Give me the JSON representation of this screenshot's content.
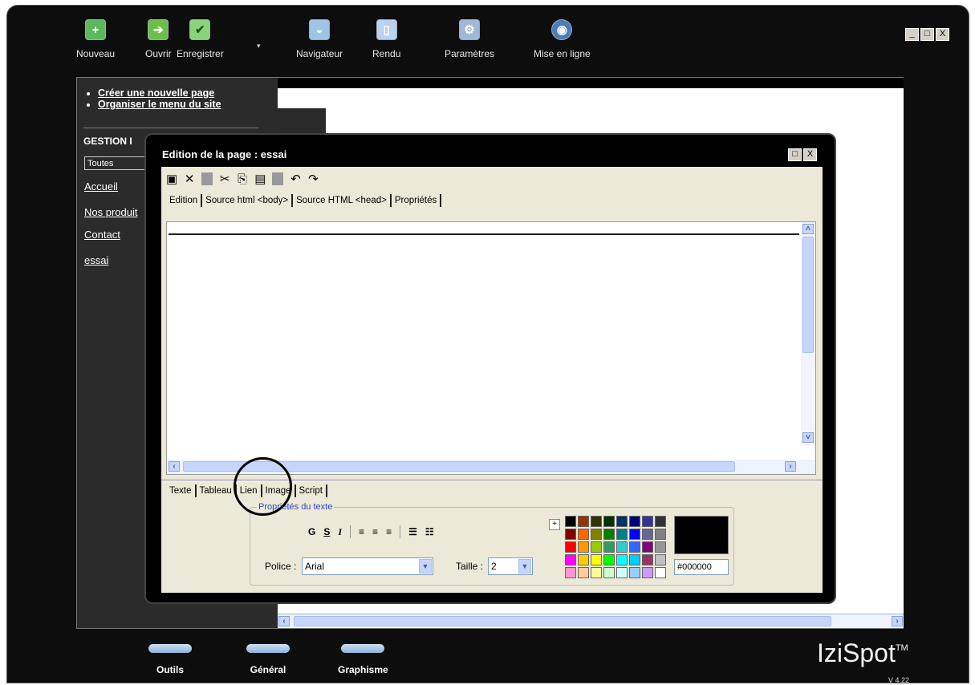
{
  "window": {
    "controls": [
      "_",
      "□",
      "X"
    ]
  },
  "toolbar": {
    "items": [
      {
        "label": "Nouveau",
        "icon": "new-plus-icon",
        "color": "#5cb85c",
        "glyph": "+"
      },
      {
        "label": "Ouvrir",
        "icon": "open-arrow-icon",
        "color": "#6cc04a",
        "glyph": "➔"
      },
      {
        "label": "Enregistrer",
        "icon": "save-check-icon",
        "color": "#8bd37a",
        "glyph": "✔"
      },
      {
        "label": "Navigateur",
        "icon": "browser-icon",
        "color": "#9fc4e8",
        "glyph": "◒"
      },
      {
        "label": "Rendu",
        "icon": "render-page-icon",
        "color": "#b9d3ef",
        "glyph": "▯"
      },
      {
        "label": "Paramètres",
        "icon": "settings-gear-icon",
        "color": "#9fb8d8",
        "glyph": "⚙"
      },
      {
        "label": "Mise en ligne",
        "icon": "globe-icon",
        "color": "#4a7db8",
        "glyph": "🌐"
      }
    ]
  },
  "sidebar": {
    "links": [
      "Créer une nouvelle page",
      "Organiser le menu du site"
    ],
    "gestion_label": "GESTION I",
    "filter_value": "Toutes",
    "pages": [
      "Accueil",
      "Nos produit",
      "Contact",
      "essai"
    ]
  },
  "dialog": {
    "title": "Edition de la page : essai",
    "tools": [
      {
        "name": "save-icon",
        "glyph": "🖫"
      },
      {
        "name": "close-icon",
        "glyph": "✕"
      },
      {
        "name": "cut-icon",
        "glyph": "✂"
      },
      {
        "name": "copy-icon",
        "glyph": "⎘"
      },
      {
        "name": "paste-icon",
        "glyph": "📋"
      },
      {
        "name": "undo-icon",
        "glyph": "↶"
      },
      {
        "name": "redo-icon",
        "glyph": "↷"
      }
    ],
    "tabs": [
      "Edition",
      "Source html <body>",
      "Source HTML <head>",
      "Propriétés"
    ],
    "lower_tabs": [
      "Texte",
      "Tableau",
      "Lien",
      "Image",
      "Script"
    ],
    "text_props": {
      "legend": "Propriétés du texte",
      "format_buttons": [
        "G",
        "S",
        "I",
        "≡",
        "≡",
        "≡",
        "☰",
        "☷"
      ],
      "font_label": "Police :",
      "font_value": "Arial",
      "size_label": "Taille :",
      "size_value": "2",
      "color_hex": "#000000",
      "palette": [
        "#000000",
        "#993300",
        "#333300",
        "#003300",
        "#003366",
        "#000080",
        "#333399",
        "#333333",
        "#800000",
        "#ff6600",
        "#808000",
        "#008000",
        "#008080",
        "#0000ff",
        "#666699",
        "#808080",
        "#ff0000",
        "#ff9900",
        "#99cc00",
        "#339966",
        "#33cccc",
        "#3366ff",
        "#800080",
        "#969696",
        "#ff00ff",
        "#ffcc00",
        "#ffff00",
        "#00ff00",
        "#00ffff",
        "#00ccff",
        "#993366",
        "#c0c0c0",
        "#ff99cc",
        "#ffcc99",
        "#ffff99",
        "#ccffcc",
        "#ccffff",
        "#99ccff",
        "#cc99ff",
        "#ffffff"
      ]
    }
  },
  "bottom_nav": [
    "Outils",
    "Général",
    "Graphisme"
  ],
  "brand": {
    "name": "IziSpot",
    "tm": "TM",
    "version": "V 4.22"
  }
}
